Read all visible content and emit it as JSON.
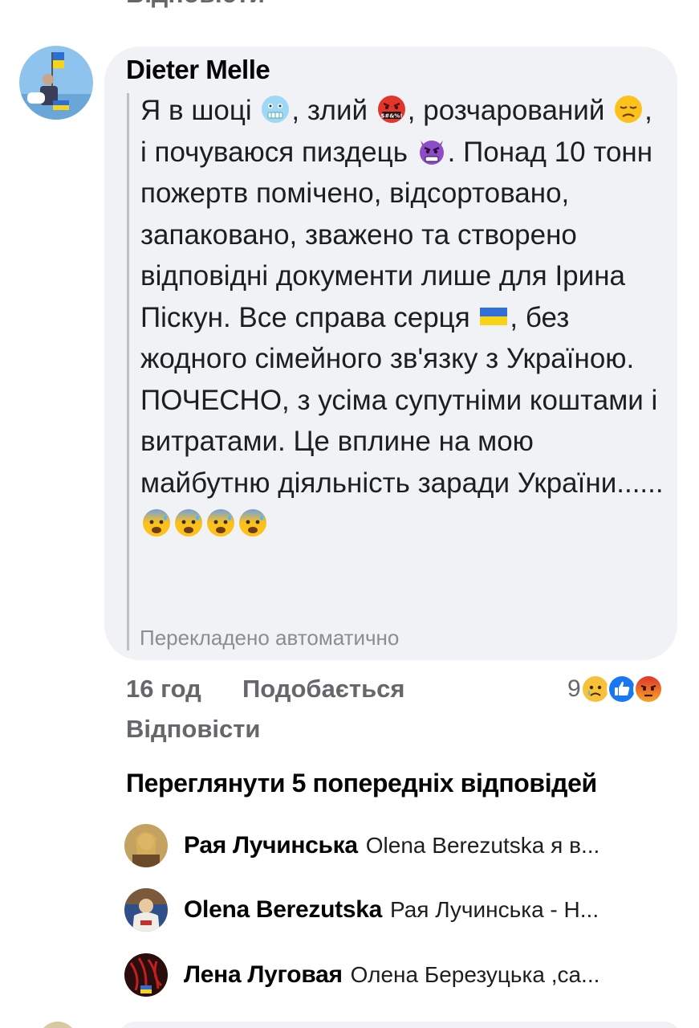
{
  "previous_reply_label": "Відповісти",
  "comment": {
    "author": "Dieter Melle",
    "text_parts": {
      "p1": "Я в шоці ",
      "p2": ", злий ",
      "p3": ", розчарований ",
      "p4": ", і почуваюся пиздець ",
      "p5": ". Понад 10 тонн пожертв помічено, відсортовано, запаковано, зважено та створено відповідні документи лише для Ірина Піскун. Все справа серця ",
      "p6": ", без жодного сімейного зв'язку з Україною. ПОЧЕСНО, з усіма супутніми коштами і витратами. Це вплине на мою майбутню діяльність заради України...... "
    },
    "emojis": [
      "cold-face",
      "cursing-face",
      "disappointed-face",
      "angry-devil-face",
      "ukraine-flag",
      "anxious-sweat-face"
    ],
    "translated_note": "Перекладено автоматично",
    "time": "16 год",
    "like_label": "Подобається",
    "reply_label": "Відповісти",
    "reaction_count": "9",
    "reaction_types": [
      "sad",
      "like",
      "angry"
    ],
    "colors": {
      "like_blue": "#1877f2",
      "angry_orange": "#e9710f",
      "bubble_bg": "#f0f2f5",
      "meta_gray": "#65676b"
    }
  },
  "view_previous_replies": "Переглянути 5 попередніх відповідей",
  "replies": [
    {
      "name": "Рая Лучинська",
      "text": "Olena Berezutska я в..."
    },
    {
      "name": "Olena Berezutska",
      "text": "Рая Лучинська - Н..."
    },
    {
      "name": "Лена Луговая",
      "text": "Олена Березуцька ,са..."
    }
  ]
}
